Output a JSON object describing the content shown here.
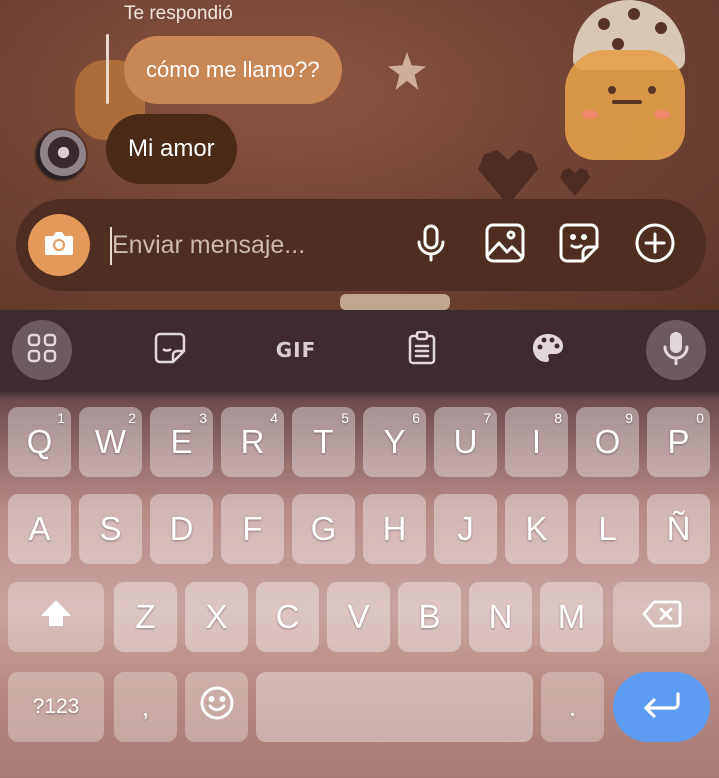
{
  "chat": {
    "reply_caption": "Te respondió",
    "quoted_message": "cómo me llamo??",
    "message": "Mi amor"
  },
  "composer": {
    "placeholder": "Enviar mensaje...",
    "icons": [
      "camera-icon",
      "microphone-icon",
      "image-icon",
      "sticker-icon",
      "add-circle-icon"
    ]
  },
  "keyboard": {
    "toolbar": {
      "gif_label": "GIF",
      "icons": [
        "apps-grid-icon",
        "sticker-icon",
        "gif-icon",
        "clipboard-icon",
        "palette-icon",
        "microphone-icon"
      ]
    },
    "rows": [
      [
        {
          "label": "Q",
          "hint": "1"
        },
        {
          "label": "W",
          "hint": "2"
        },
        {
          "label": "E",
          "hint": "3"
        },
        {
          "label": "R",
          "hint": "4"
        },
        {
          "label": "T",
          "hint": "5"
        },
        {
          "label": "Y",
          "hint": "6"
        },
        {
          "label": "U",
          "hint": "7"
        },
        {
          "label": "I",
          "hint": "8"
        },
        {
          "label": "O",
          "hint": "9"
        },
        {
          "label": "P",
          "hint": "0"
        }
      ],
      [
        {
          "label": "A"
        },
        {
          "label": "S"
        },
        {
          "label": "D"
        },
        {
          "label": "F"
        },
        {
          "label": "G"
        },
        {
          "label": "H"
        },
        {
          "label": "J"
        },
        {
          "label": "K"
        },
        {
          "label": "L"
        },
        {
          "label": "Ñ"
        }
      ],
      [
        {
          "label": "Z"
        },
        {
          "label": "X"
        },
        {
          "label": "C"
        },
        {
          "label": "V"
        },
        {
          "label": "B"
        },
        {
          "label": "N"
        },
        {
          "label": "M"
        }
      ]
    ],
    "bottom": {
      "symbols_label": "?123",
      "comma_label": ",",
      "period_label": "."
    },
    "colors": {
      "enter_key": "#5c9cf2",
      "camera_button": "#e49a5b"
    }
  }
}
